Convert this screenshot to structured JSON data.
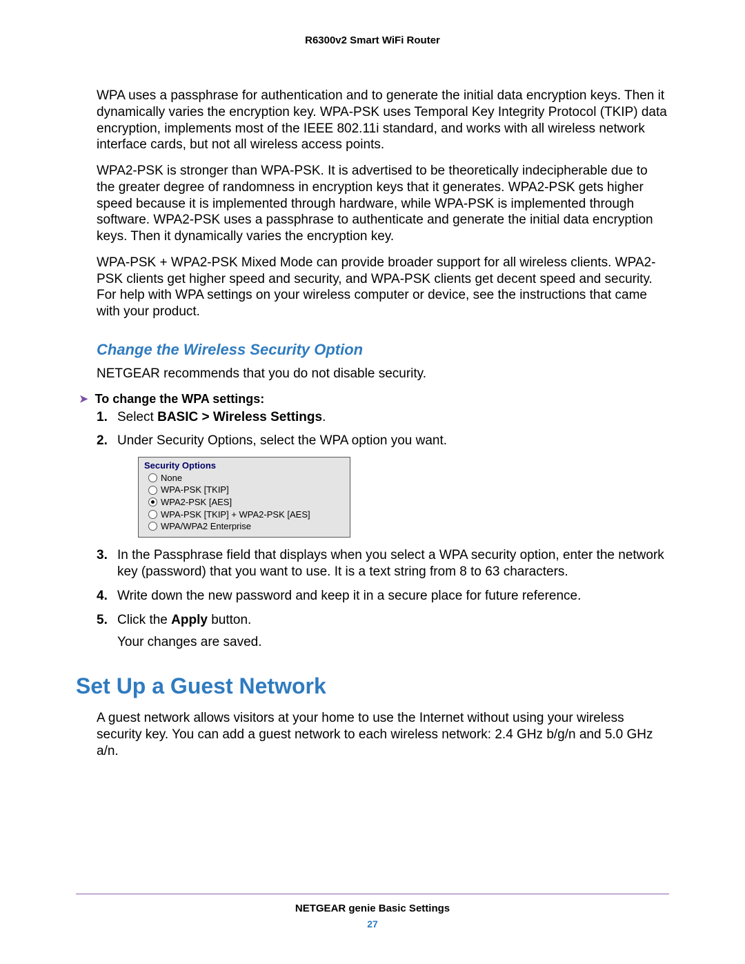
{
  "header": "R6300v2 Smart WiFi Router",
  "para1": "WPA uses a passphrase for authentication and to generate the initial data encryption keys. Then it dynamically varies the encryption key. WPA-PSK uses Temporal Key Integrity Protocol (TKIP) data encryption, implements most of the IEEE 802.11i standard, and works with all wireless network interface cards, but not all wireless access points.",
  "para2": "WPA2-PSK is stronger than WPA-PSK. It is advertised to be theoretically indecipherable due to the greater degree of randomness in encryption keys that it generates. WPA2-PSK gets higher speed because it is implemented through hardware, while WPA-PSK is implemented through software. WPA2-PSK uses a passphrase to authenticate and generate the initial data encryption keys. Then it dynamically varies the encryption key.",
  "para3": "WPA-PSK + WPA2-PSK Mixed Mode can provide broader support for all wireless clients. WPA2-PSK clients get higher speed and security, and WPA-PSK clients get decent speed and security. For help with WPA settings on your wireless computer or device, see the instructions that came with your product.",
  "sub1": "Change the Wireless Security Option",
  "recommend": "NETGEAR recommends that you do not disable security.",
  "proc_arrow": "➤",
  "proc_heading": "To change the WPA settings:",
  "step1_pre": "Select ",
  "step1_bold": "BASIC > Wireless Settings",
  "step1_post": ".",
  "step2": "Under Security Options, select the WPA option you want.",
  "secopt": {
    "title": "Security Options",
    "opts": [
      "None",
      "WPA-PSK [TKIP]",
      "WPA2-PSK [AES]",
      "WPA-PSK [TKIP] + WPA2-PSK [AES]",
      "WPA/WPA2 Enterprise"
    ],
    "selected_index": 2
  },
  "step3": "In the Passphrase field that displays when you select a WPA security option, enter the network key (password) that you want to use. It is a text string from 8 to 63 characters.",
  "step4": "Write down the new password and keep it in a secure place for future reference.",
  "step5_pre": "Click the ",
  "step5_bold": "Apply",
  "step5_post": " button.",
  "step5_sub": "Your changes are saved.",
  "h2": "Set Up a Guest Network",
  "guest_para": "A guest network allows visitors at your home to use the Internet without using your wireless security key. You can add a guest network to each wireless network: 2.4 GHz b/g/n and 5.0 GHz a/n.",
  "footer_title": "NETGEAR genie Basic Settings",
  "footer_page": "27"
}
